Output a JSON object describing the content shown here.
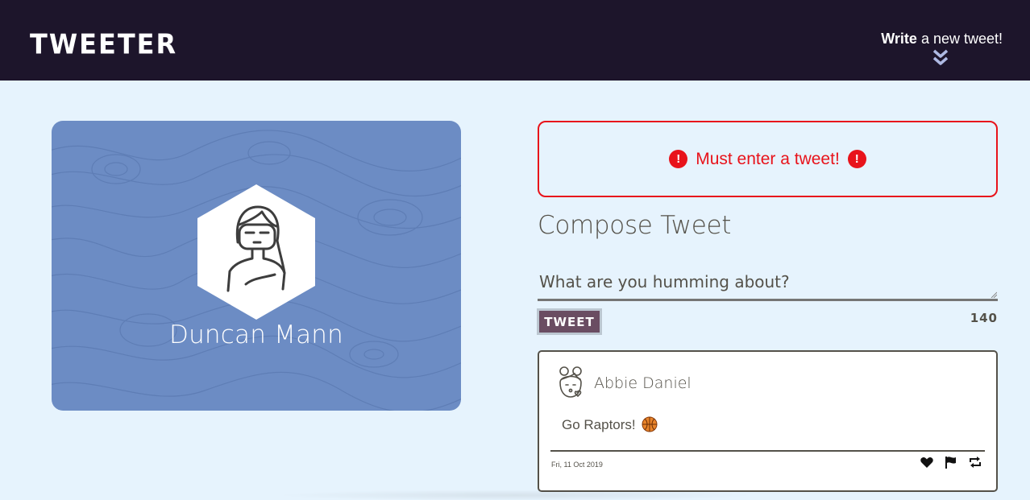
{
  "nav": {
    "brand": "TWEETER",
    "write_bold": "Write",
    "write_rest": " a new tweet!"
  },
  "profile": {
    "name": "Duncan Mann",
    "card_color": "#6c8cc4"
  },
  "compose": {
    "error_text": "Must enter a tweet!",
    "title": "Compose Tweet",
    "placeholder": "What are you humming about?",
    "button_label": "TWEET",
    "counter": "140"
  },
  "tweets": [
    {
      "author": "Abbie Daniel",
      "text": "Go Raptors! ",
      "date": "Fri, 11 Oct 2019"
    }
  ],
  "colors": {
    "nav_bg": "#1d152b",
    "page_bg": "#e6f3fd",
    "error": "#e8131b",
    "button": "#6a4d62"
  }
}
